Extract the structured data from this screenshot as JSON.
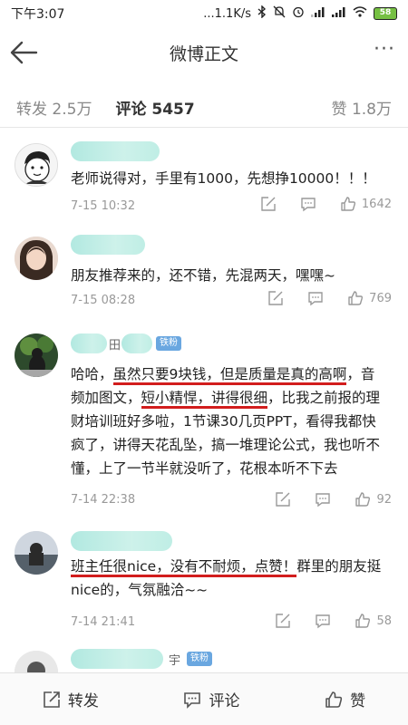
{
  "status_bar": {
    "time": "下午3:07",
    "network_speed": "...1.1K/s",
    "battery": "58"
  },
  "nav": {
    "title": "微博正文",
    "more": "···"
  },
  "tabs": {
    "repost": "转发 2.5万",
    "comments": "评论 5457",
    "likes": "赞 1.8万"
  },
  "comments": [
    {
      "text": "老师说得对，手里有1000，先想挣10000！！！",
      "time": "7-15 10:32",
      "likes": "1642"
    },
    {
      "text": "朋友推荐来的，还不错，先混两天，嘿嘿~",
      "time": "7-15 08:28",
      "likes": "769"
    },
    {
      "name_fragment": "田",
      "badge": "铁粉",
      "text_parts": {
        "p1": "哈哈，",
        "p2": "虽然只要9块钱，但是质量是真的高啊",
        "p3": "，音频加图文，",
        "p4": "短小精悍，讲得很细",
        "p5": "，比我之前报的理财培训班好多啦，1节课30几页PPT，看得我都快疯了，讲得天花乱坠，搞一堆理论公式，我也听不懂，上了一节半就没听了，花根本听不下去"
      },
      "time": "7-14 22:38",
      "likes": "92"
    },
    {
      "text_parts": {
        "p1": "班主任很nice，没有不耐烦，点赞！",
        "p2": "群里的朋友挺nice的，气氛融洽~~"
      },
      "time": "7-14 21:41",
      "likes": "58"
    },
    {
      "name_fragment": "宇",
      "badge": "铁粉"
    }
  ],
  "bottom_bar": {
    "repost": "转发",
    "comment": "评论",
    "like": "赞"
  }
}
